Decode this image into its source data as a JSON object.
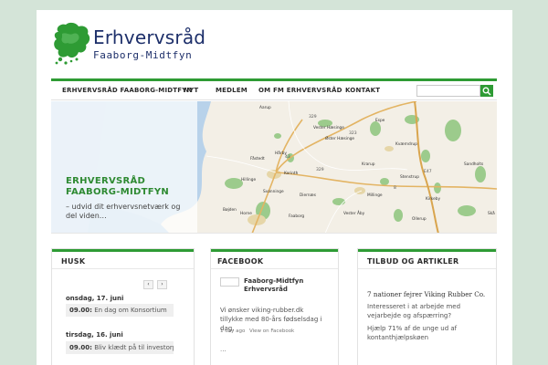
{
  "header": {
    "logo_title": "Erhvervsråd",
    "logo_subtitle": "Faaborg-Midtfyn",
    "brand_color": "#2e9b34",
    "navy_color": "#1d2f6a"
  },
  "nav": {
    "items": [
      {
        "label": "ERHVERVSRÅD FAABORG-MIDTFYN"
      },
      {
        "label": "NYT"
      },
      {
        "label": "MEDLEM"
      },
      {
        "label": "OM FM ERHVERVSRÅD"
      },
      {
        "label": "KONTAKT"
      }
    ],
    "search": {
      "value": "",
      "placeholder": "",
      "icon": "search-icon"
    }
  },
  "hero": {
    "title": "ERHVERVSRÅD FAABORG-MIDTFYN",
    "subtitle": "– udvid dit erhvervsnetværk og del viden…",
    "map": {
      "towns": [
        "Aarup",
        "Vester Hæsinge",
        "Øster Hæsinge",
        "Espe",
        "Kværndrup",
        "Hårby",
        "Korinth",
        "Krarup",
        "Stenstrup",
        "Fåstedt",
        "Hillinge",
        "Diernæs",
        "Vester Åby",
        "Millinge",
        "Faaborg",
        "Horne",
        "Bøjden",
        "Kirkeby",
        "Svanninge",
        "Ollerup",
        "Sandholts",
        "Skå"
      ],
      "roads": [
        "329",
        "323",
        "43",
        "329",
        "8",
        "E47"
      ]
    }
  },
  "boxes": {
    "husk": {
      "title": "HUSK",
      "prev_icon": "chevron-left-icon",
      "next_icon": "chevron-right-icon",
      "prev_label": "‹",
      "next_label": "›",
      "events": [
        {
          "date": "onsdag, 17. juni",
          "time": "09.00:",
          "text": "En dag om Konsortium"
        },
        {
          "date": "tirsdag, 16. juni",
          "time": "09.00:",
          "text": "Bliv klædt på til investorpr"
        }
      ]
    },
    "facebook": {
      "title": "FACEBOOK",
      "page_name": "Faaborg-Midtfyn Erhvervsråd",
      "post_text": "Vi ønsker viking-rubber.dk tillykke med 80-års fødselsdag i dag.",
      "time_ago": "1 day ago",
      "view_link": "View on Facebook",
      "more": "..."
    },
    "tilbud": {
      "title": "TILBUD OG ARTIKLER",
      "articles": [
        "7 nationer fejrer Viking Rubber Co.",
        "Interesseret i at arbejde med vejarbejde og afspærring?",
        "Hjælp 71% af de unge ud af kontanthjælpskøen"
      ]
    }
  }
}
